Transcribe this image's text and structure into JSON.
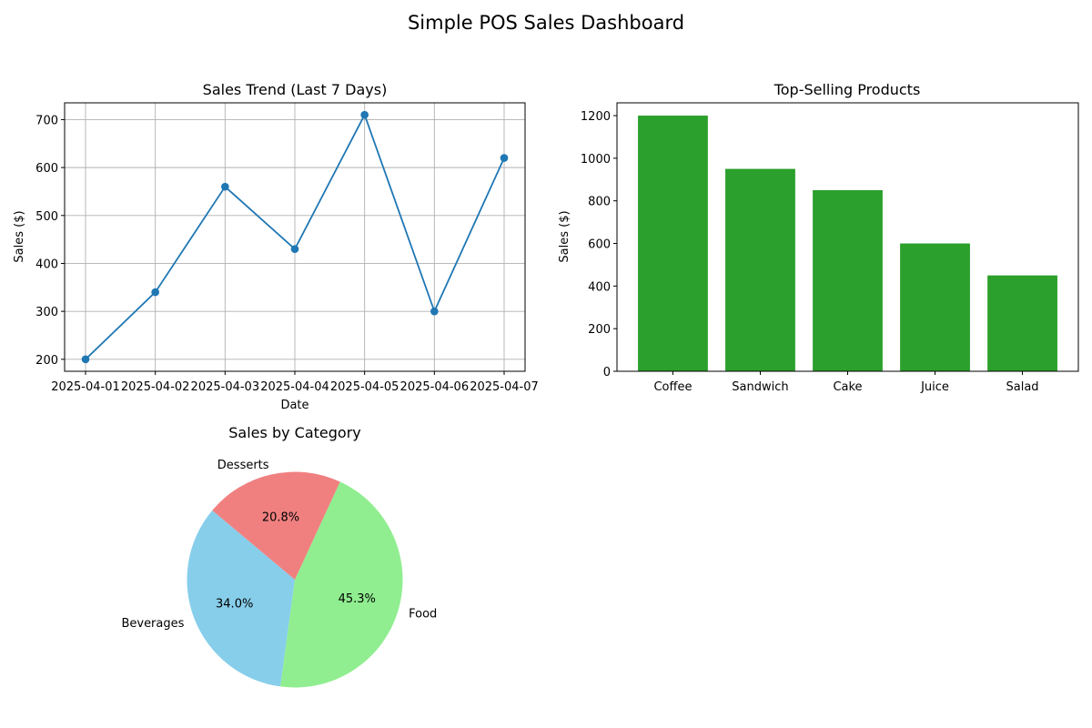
{
  "page": {
    "title": "Simple POS Sales Dashboard"
  },
  "chart_data": [
    {
      "type": "line",
      "title": "Sales Trend (Last 7 Days)",
      "xlabel": "Date",
      "ylabel": "Sales ($)",
      "x": [
        "2025-04-01",
        "2025-04-02",
        "2025-04-03",
        "2025-04-04",
        "2025-04-05",
        "2025-04-06",
        "2025-04-07"
      ],
      "values": [
        200,
        340,
        560,
        430,
        710,
        300,
        620
      ],
      "yticks": [
        200,
        300,
        400,
        500,
        600,
        700
      ],
      "ylim": [
        175,
        735
      ],
      "grid": true,
      "marker": "circle",
      "color": "#1f77b4"
    },
    {
      "type": "bar",
      "title": "Top-Selling Products",
      "xlabel": "",
      "ylabel": "Sales ($)",
      "categories": [
        "Coffee",
        "Sandwich",
        "Cake",
        "Juice",
        "Salad"
      ],
      "values": [
        1200,
        950,
        850,
        600,
        450
      ],
      "yticks": [
        0,
        200,
        400,
        600,
        800,
        1000,
        1200
      ],
      "ylim": [
        0,
        1260
      ],
      "grid": false,
      "color": "#2ca02c"
    },
    {
      "type": "pie",
      "title": "Sales by Category",
      "start_angle_deg": 140,
      "slices": [
        {
          "label": "Beverages",
          "value": 34.0,
          "pct_label": "34.0%",
          "color": "#87ceeb"
        },
        {
          "label": "Food",
          "value": 45.3,
          "pct_label": "45.3%",
          "color": "#90ee90"
        },
        {
          "label": "Desserts",
          "value": 20.8,
          "pct_label": "20.8%",
          "color": "#f08080"
        }
      ]
    }
  ]
}
